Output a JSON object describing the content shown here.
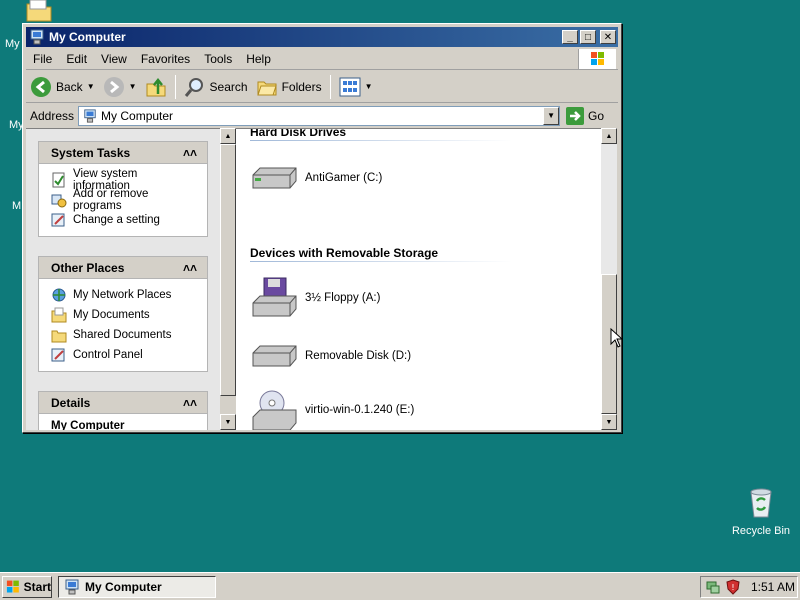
{
  "desktop": {
    "icon_fragments": [
      "My",
      "My",
      "M"
    ],
    "recycle_bin": "Recycle Bin"
  },
  "window": {
    "title": "My Computer",
    "controls": {
      "minimize": "_",
      "maximize": "□",
      "close": "✕"
    },
    "menu": [
      "File",
      "Edit",
      "View",
      "Favorites",
      "Tools",
      "Help"
    ],
    "toolbar": {
      "back": "Back",
      "search": "Search",
      "folders": "Folders"
    },
    "address": {
      "label": "Address",
      "value": "My Computer",
      "go": "Go"
    }
  },
  "left_pane": {
    "system_tasks": {
      "title": "System Tasks",
      "items": [
        "View system information",
        "Add or remove programs",
        "Change a setting"
      ]
    },
    "other_places": {
      "title": "Other Places",
      "items": [
        "My Network Places",
        "My Documents",
        "Shared Documents",
        "Control Panel"
      ]
    },
    "details": {
      "title": "Details",
      "first_line": "My Computer"
    }
  },
  "main": {
    "hard_disks": {
      "title": "Hard Disk Drives",
      "drives": [
        "AntiGamer (C:)"
      ]
    },
    "removable": {
      "title": "Devices with Removable Storage",
      "drives": [
        "3½ Floppy (A:)",
        "Removable Disk (D:)",
        "virtio-win-0.1.240 (E:)"
      ]
    }
  },
  "taskbar": {
    "start": "Start",
    "task": "My Computer",
    "clock": "1:51 AM"
  },
  "colors": {
    "desktop": "#0e7a7a",
    "titlebar_start": "#0a246a",
    "titlebar_end": "#3a6ea5"
  }
}
